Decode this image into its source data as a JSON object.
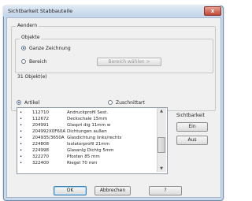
{
  "window": {
    "title": "Sichtbarkeit Stabbauteile",
    "close_glyph": "x"
  },
  "section": {
    "aendern": "Aendern",
    "objekte": "Objekte",
    "ganze_zeichnung": "Ganze Zeichnung",
    "bereich": "Bereich",
    "bereich_button": "Bereich wählen >",
    "object_count": "31 Objekt(e)"
  },
  "mode": {
    "artikel": "Artikel",
    "zuschnitt": "Zuschnittart"
  },
  "visibility": {
    "title": "Sichtbarkeit",
    "ein": "Ein",
    "aus": "Aus"
  },
  "list": {
    "rows": [
      {
        "marker": "•",
        "number": "112710",
        "desc": "Andruckprofil Sest."
      },
      {
        "marker": "•",
        "number": "112672",
        "desc": "Deckschale 15mm"
      },
      {
        "marker": "•",
        "number": "204991",
        "desc": "Glaspri dig 11mm w"
      },
      {
        "marker": "•",
        "number": "204992X0F60A",
        "desc": "Dichtungen außen"
      },
      {
        "marker": "•",
        "number": "204935/3650A",
        "desc": "Glasdichtung links/rechts"
      },
      {
        "marker": "•",
        "number": "224808",
        "desc": "Isolatorprofil 21mm"
      },
      {
        "marker": "•",
        "number": "224998",
        "desc": "Glasanlg Dichtg 5mm"
      },
      {
        "marker": "•",
        "number": "322270",
        "desc": "Pfosten 85 mm"
      },
      {
        "marker": "•",
        "number": "322400",
        "desc": "Riegel 70 mm"
      }
    ]
  },
  "buttons": {
    "ok": "OK",
    "abbrechen": "Abbrechen",
    "help": "?"
  }
}
